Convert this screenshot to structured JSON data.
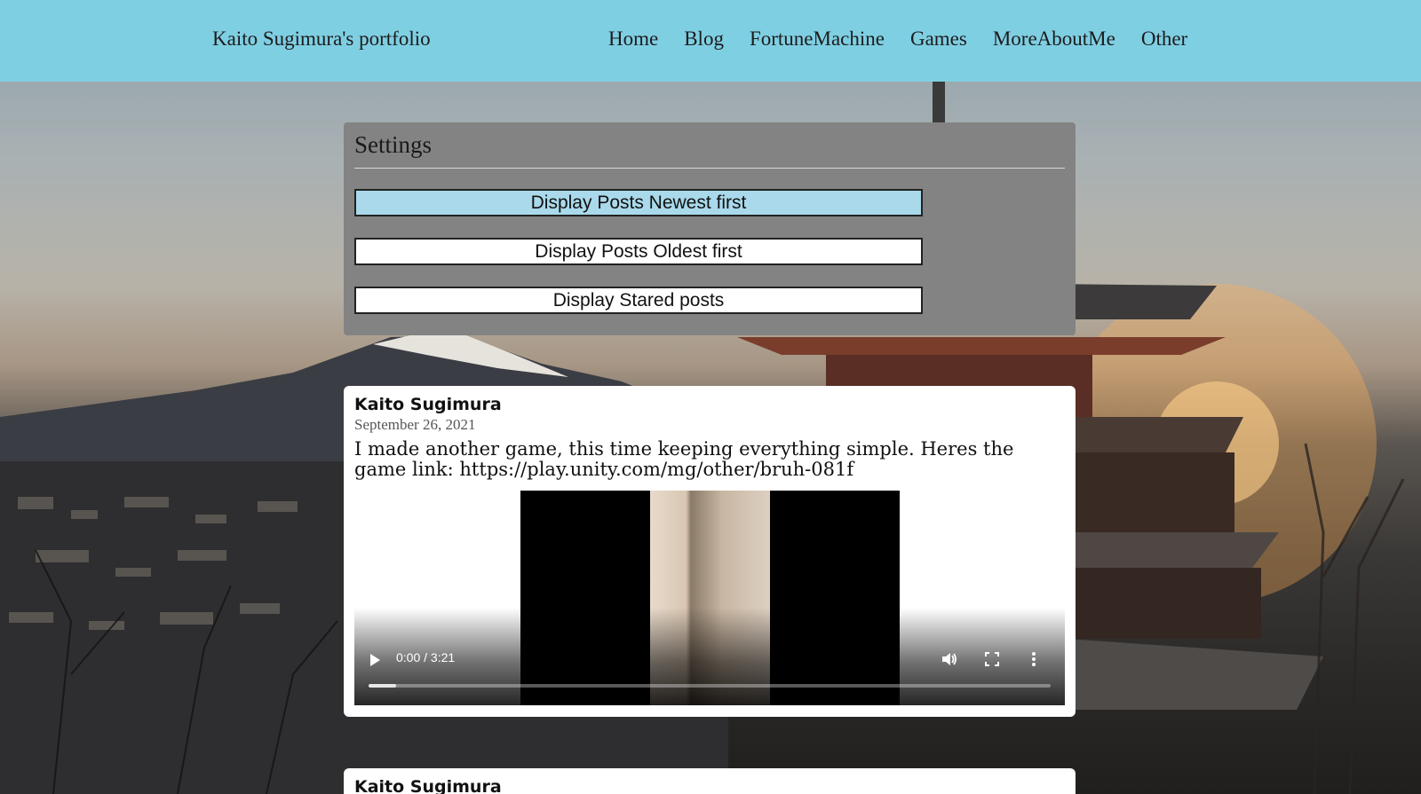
{
  "header": {
    "site_title": "Kaito Sugimura's portfolio",
    "nav": [
      "Home",
      "Blog",
      "FortuneMachine",
      "Games",
      "MoreAboutMe",
      "Other"
    ],
    "bg_color": "#7fcfe3"
  },
  "settings": {
    "title": "Settings",
    "buttons": [
      "Display Posts Newest first",
      "Display Posts Oldest first",
      "Display Stared posts"
    ],
    "active_button": "Display Posts Newest first",
    "active_color": "#a9d9eb",
    "panel_color": "#838383"
  },
  "posts": [
    {
      "author": "Kaito Sugimura",
      "date": "September 26, 2021",
      "body": "I made another game, this time keeping everything simple. Heres the game link: https://play.unity.com/mg/other/bruh-081f",
      "video": {
        "time": "0:00 / 3:21",
        "progress": 0.04,
        "icons": [
          "play-icon",
          "volume-icon",
          "fullscreen-icon",
          "more-options-icon"
        ]
      }
    },
    {
      "author": "Kaito Sugimura"
    }
  ],
  "background": {
    "description_icons": [
      "mountain",
      "pagoda",
      "city",
      "sunset"
    ]
  }
}
